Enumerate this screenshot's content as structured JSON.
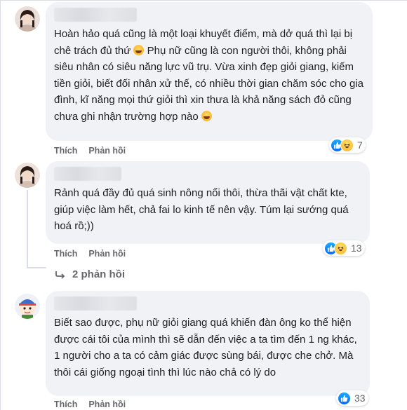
{
  "comments": [
    {
      "text_before_emoji_1": "Hoàn hảo quá cũng là một loại khuyết điểm, mà dở quá thì lại bị chê trách đủ thứ ",
      "text_middle": " Phụ nữ cũng là con người thôi, không phải siêu nhân có siêu năng lực vũ trụ. Vừa xinh đẹp giỏi giang, kiếm tiền giỏi, biết đối nhân xử thế, có nhiều thời gian chăm sóc cho gia đình, kĩ năng mọi thứ giỏi thì xin thưa là khả năng sách đỏ cũng chưa ghi nhận trường hợp nào ",
      "like_label": "Thích",
      "reply_label": "Phản hồi",
      "reaction_count": "7",
      "reaction_icons": [
        "like-icon",
        "haha-icon"
      ]
    },
    {
      "text": "Rảnh quá đầy đủ quá sinh nông nổi thôi, thừa thãi vật chất kte, giúp việc làm hết, chả fai lo kinh tế nên vậy. Túm lại sướng quá hoá rồ;))",
      "like_label": "Thích",
      "reply_label": "Phản hồi",
      "reaction_count": "13",
      "reaction_icons": [
        "like-icon",
        "haha-icon"
      ],
      "replies_label": "2 phản hồi"
    },
    {
      "text": "Biết sao được, phụ nữ giỏi giang quá khiến đàn ông ko thể hiện được cái tôi của mình thì sẽ dẫn đến việc a ta tìm đến 1 ng khác, 1 người cho a ta có cảm giác được sùng bái, được che chở. Mà thôi cái giống ngoại tình thì lúc nào chả có lý do",
      "like_label": "Thích",
      "reply_label": "Phản hồi",
      "reaction_count": "33",
      "reaction_icons": [
        "like-icon"
      ]
    }
  ],
  "colors": {
    "bubble": "#f0f2f5",
    "secondary_text": "#65676b",
    "like_blue": "#0866ff",
    "haha_yellow": "#f7b125"
  }
}
